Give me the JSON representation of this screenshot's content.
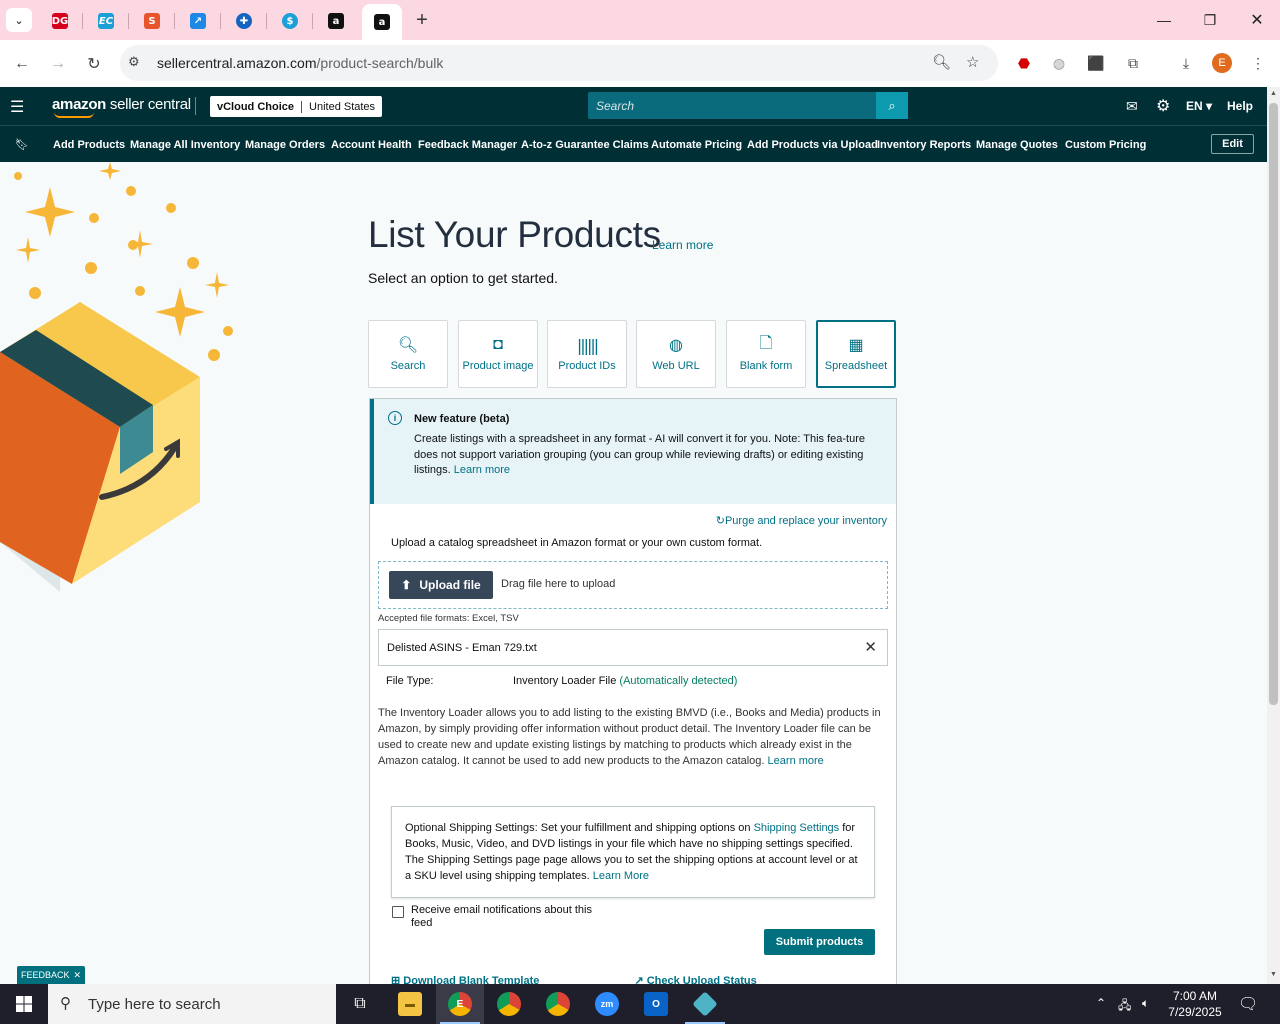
{
  "browser": {
    "tabs": [
      {
        "icon": "dollar-general-favicon",
        "color": "#d6001c",
        "glyph": "DG"
      },
      {
        "icon": "ec-favicon",
        "color": "#1a9fd6",
        "glyph": "EC"
      },
      {
        "icon": "sellerapp-favicon",
        "color": "#e8552d",
        "glyph": "S"
      },
      {
        "icon": "tool-favicon",
        "color": "#1e88e5",
        "glyph": "↗"
      },
      {
        "icon": "network-favicon",
        "color": "#1565c0",
        "glyph": "✚"
      },
      {
        "icon": "dollar-favicon",
        "color": "#1ba0d8",
        "glyph": "$"
      },
      {
        "icon": "amazon-favicon",
        "color": "#111111",
        "glyph": "a"
      },
      {
        "icon": "amazon-favicon",
        "color": "#111111",
        "glyph": "a"
      }
    ],
    "url_host": "sellercentral.amazon.com",
    "url_path": "/product-search/bulk",
    "profile_initial": "E"
  },
  "header": {
    "logo_bold": "amazon",
    "logo_light": " seller central",
    "store_name": "vCloud Choice",
    "marketplace": "United States",
    "search_placeholder": "Search",
    "language": "EN ▾",
    "help": "Help"
  },
  "nav": {
    "items": [
      "Add Products",
      "Manage All Inventory",
      "Manage Orders",
      "Account Health",
      "Feedback Manager",
      "A-to-z Guarantee Claims",
      "Automate Pricing",
      "Add Products via Upload",
      "Inventory Reports",
      "Manage Quotes",
      "Custom Pricing"
    ],
    "edit": "Edit"
  },
  "main": {
    "title": "List Your Products",
    "learn_more": "Learn more",
    "subtitle": "Select an option to get started.",
    "options": [
      {
        "label": "Search",
        "icon": "search-plus-icon"
      },
      {
        "label": "Product image",
        "icon": "camera-icon"
      },
      {
        "label": "Product IDs",
        "icon": "barcode-icon"
      },
      {
        "label": "Web URL",
        "icon": "globe-icon"
      },
      {
        "label": "Blank form",
        "icon": "document-icon"
      },
      {
        "label": "Spreadsheet",
        "icon": "spreadsheet-icon"
      }
    ],
    "selected_option": "Spreadsheet",
    "beta": {
      "title": "New feature (beta)",
      "body": "Create listings with a spreadsheet in any format - AI will convert it for you. Note: This fea-ture does not support variation grouping (you can group while reviewing drafts) or editing existing listings.",
      "link": "Learn more"
    },
    "purge_link": "Purge and replace your inventory",
    "upload_instructions": "Upload a catalog spreadsheet in Amazon format or your own custom format.",
    "upload_button": "Upload file",
    "drag_text": "Drag file here to upload",
    "accepted_formats": "Accepted file formats: Excel, TSV",
    "file_name": "Delisted ASINS - Eman 729.txt",
    "file_type_label": "File Type:",
    "file_type_value": "Inventory Loader File",
    "file_type_detected": "(Automatically detected)",
    "description": "The Inventory Loader allows you to add listing to the existing BMVD (i.e., Books and Media) products in Amazon, by simply providing offer information without product detail. The Inventory Loader file can be used to create new and update existing listings by matching to products which already exist in the Amazon catalog. It cannot be used to add new products to the Amazon catalog.",
    "description_link": "Learn more",
    "shipping": {
      "before": "Optional Shipping Settings: Set your fulfillment and shipping options on ",
      "link": "Shipping Settings",
      "after": " for Books, Music, Video, and DVD listings in your file which have no shipping settings specified. The Shipping Settings page page allows you to set the shipping options at account level or at a SKU level using shipping templates.",
      "learn_more": "Learn More"
    },
    "email_checkbox_label": "Receive email notifications about this feed",
    "email_checked": false,
    "submit_button": "Submit products",
    "download_template": "Download Blank Template",
    "check_status": "Check Upload Status"
  },
  "feedback": "FEEDBACK",
  "taskbar": {
    "search_placeholder": "Type here to search",
    "time": "7:00 AM",
    "date": "7/29/2025"
  }
}
